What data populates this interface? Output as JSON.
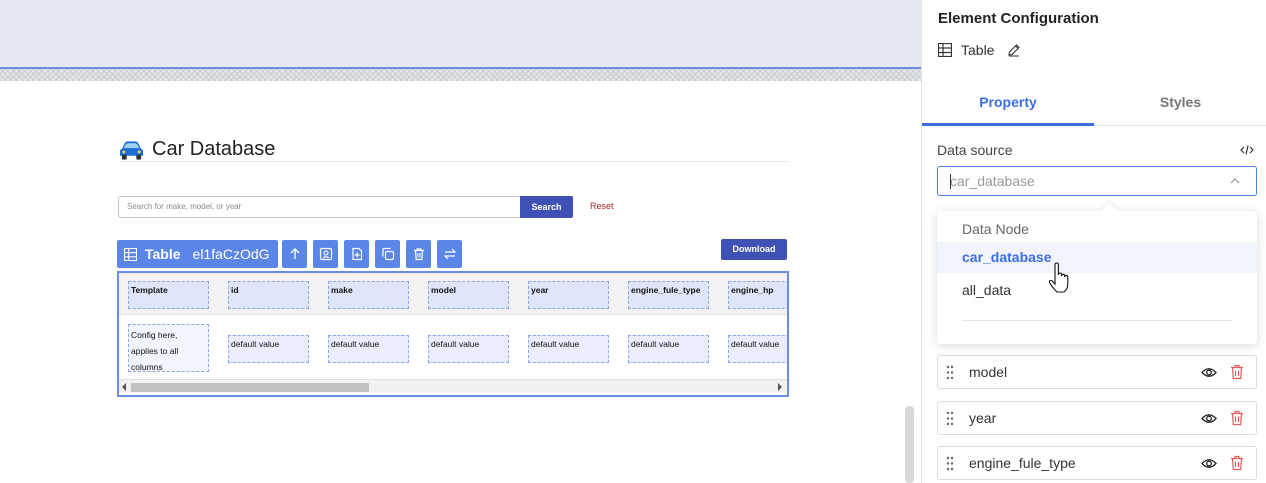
{
  "canvas": {
    "app_title": "Car Database",
    "search": {
      "placeholder": "Search for make, model, or year",
      "button_label": "Search",
      "reset_label": "Reset"
    },
    "element_chip": {
      "name": "Table",
      "id": "el1faCzOdG"
    },
    "toolbar_icons": [
      "arrow-up-icon",
      "settings-form-icon",
      "add-file-icon",
      "copy-icon",
      "trash-icon",
      "swap-icon"
    ],
    "download_label": "Download",
    "table": {
      "headers": [
        "Template",
        "id",
        "make",
        "model",
        "year",
        "engine_fule_type",
        "engine_hp"
      ],
      "template_cell": "Config here, applies to all columns",
      "default_cell": "default value"
    }
  },
  "panel": {
    "title": "Element Configuration",
    "element_type": "Table",
    "tabs": [
      "Property",
      "Styles"
    ],
    "active_tab": "Property",
    "data_source": {
      "label": "Data source",
      "value": "car_database",
      "dropdown": {
        "group_label": "Data Node",
        "options": [
          "car_database",
          "all_data"
        ],
        "selected": "car_database"
      }
    },
    "columns": [
      "model",
      "year",
      "engine_fule_type"
    ]
  },
  "colors": {
    "accent": "#3d6ee0",
    "primary_button": "#3f51b5",
    "chip": "#5a86e8",
    "danger": "#e05a5a"
  }
}
